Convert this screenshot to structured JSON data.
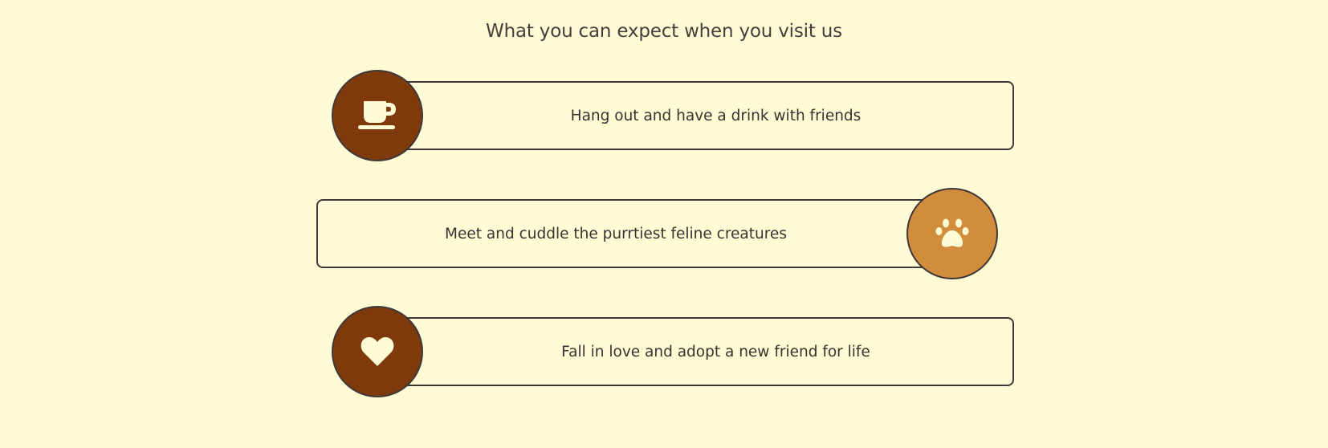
{
  "section": {
    "heading": "What you can expect when you visit us"
  },
  "features": [
    {
      "text": "Hang out and have a drink with friends",
      "icon": "coffee-cup-icon",
      "badge_color": "#7f3a0c",
      "badge_side": "left"
    },
    {
      "text": "Meet and cuddle the purrtiest feline creatures",
      "icon": "paw-icon",
      "badge_color": "#d18c3c",
      "badge_side": "right"
    },
    {
      "text": "Fall in love and adopt a new friend for life",
      "icon": "heart-icon",
      "badge_color": "#7f3a0c",
      "badge_side": "left"
    }
  ],
  "colors": {
    "background": "#fffbd4",
    "border": "#3f3838",
    "icon": "#fffbd4",
    "text": "#3a3030"
  }
}
